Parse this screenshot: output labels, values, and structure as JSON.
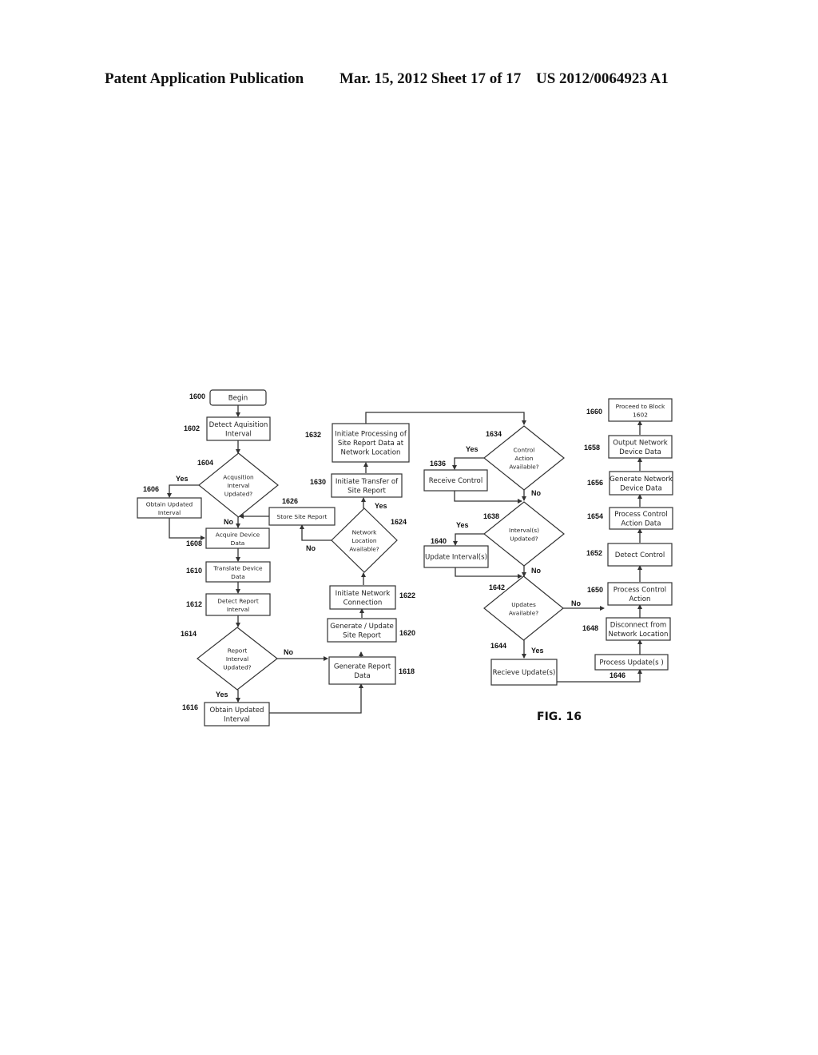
{
  "header": {
    "publication": "Patent Application Publication",
    "date_sheet": "Mar. 15, 2012  Sheet 17 of 17",
    "number": "US 2012/0064923 A1"
  },
  "figure_label": "FIG. 16",
  "nodes": {
    "n1600": {
      "ref": "1600",
      "lines": [
        "Begin"
      ]
    },
    "n1602": {
      "ref": "1602",
      "lines": [
        "Detect Aquisition",
        "Interval"
      ]
    },
    "n1604": {
      "ref": "1604",
      "lines": [
        "Acqusition",
        "Interval",
        "Updated?"
      ]
    },
    "n1606": {
      "ref": "1606",
      "lines": [
        "Obtain Updated",
        "Interval"
      ]
    },
    "n1608": {
      "ref": "1608",
      "lines": [
        "Acquire Device",
        "Data"
      ]
    },
    "n1610": {
      "ref": "1610",
      "lines": [
        "Translate Device",
        "Data"
      ]
    },
    "n1612": {
      "ref": "1612",
      "lines": [
        "Detect Report",
        "Interval"
      ]
    },
    "n1614": {
      "ref": "1614",
      "lines": [
        "Report",
        "Interval",
        "Updated?"
      ]
    },
    "n1616": {
      "ref": "1616",
      "lines": [
        "Obtain Updated",
        "Interval"
      ]
    },
    "n1618": {
      "ref": "1618",
      "lines": [
        "Generate Report",
        "Data"
      ]
    },
    "n1620": {
      "ref": "1620",
      "lines": [
        "Generate / Update",
        "Site Report"
      ]
    },
    "n1622": {
      "ref": "1622",
      "lines": [
        "Initiate Network",
        "Connection"
      ]
    },
    "n1624": {
      "ref": "1624",
      "lines": [
        "Network",
        "Location",
        "Available?"
      ]
    },
    "n1626": {
      "ref": "1626",
      "lines": [
        "Store Site Report"
      ]
    },
    "n1630": {
      "ref": "1630",
      "lines": [
        "Initiate Transfer of",
        "Site Report"
      ]
    },
    "n1632": {
      "ref": "1632",
      "lines": [
        "Initiate Processing of",
        "Site Report Data at",
        "Network Location"
      ]
    },
    "n1634": {
      "ref": "1634",
      "lines": [
        "Control",
        "Action",
        "Available?"
      ]
    },
    "n1636": {
      "ref": "1636",
      "lines": [
        "Receive Control"
      ]
    },
    "n1638": {
      "ref": "1638",
      "lines": [
        "Interval(s)",
        "Updated?"
      ]
    },
    "n1640": {
      "ref": "1640",
      "lines": [
        "Update Interval(s)"
      ]
    },
    "n1642": {
      "ref": "1642",
      "lines": [
        "Updates",
        "Available?"
      ]
    },
    "n1644": {
      "ref": "1644",
      "lines": [
        "Recieve Update(s)"
      ]
    },
    "n1646": {
      "ref": "1646",
      "lines": [
        "Process Update(s )"
      ]
    },
    "n1648": {
      "ref": "1648",
      "lines": [
        "Disconnect from",
        "Network Location"
      ]
    },
    "n1650": {
      "ref": "1650",
      "lines": [
        "Process Control",
        "Action"
      ]
    },
    "n1652": {
      "ref": "1652",
      "lines": [
        "Detect Control"
      ]
    },
    "n1654": {
      "ref": "1654",
      "lines": [
        "Process Control",
        "Action Data"
      ]
    },
    "n1656": {
      "ref": "1656",
      "lines": [
        "Generate Network",
        "Device Data"
      ]
    },
    "n1658": {
      "ref": "1658",
      "lines": [
        "Output Network",
        "Device Data"
      ]
    },
    "n1660": {
      "ref": "1660",
      "lines": [
        "Proceed to Block",
        "1602"
      ]
    }
  },
  "branch_labels": {
    "yes": "Yes",
    "no": "No"
  }
}
